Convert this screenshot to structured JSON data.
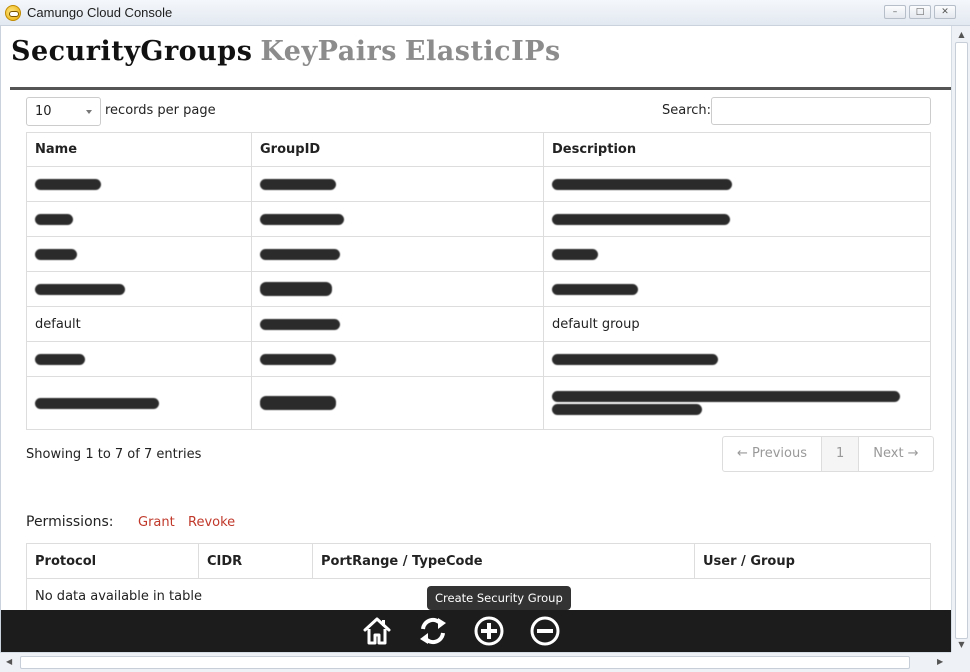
{
  "window": {
    "title": "Camungo Cloud Console"
  },
  "nav": {
    "security_groups": "SecurityGroups",
    "key_pairs": "KeyPairs",
    "elastic_ips": "ElasticIPs"
  },
  "table_controls": {
    "page_length": "10",
    "records_label": "records per page",
    "search_label": "Search:",
    "search_value": ""
  },
  "groups_table": {
    "headers": [
      "Name",
      "GroupID",
      "Description"
    ],
    "rows": [
      [
        "[redacted]",
        "[redacted]",
        "[redacted]"
      ],
      [
        "[redacted]",
        "[redacted]",
        "[redacted]"
      ],
      [
        "[redacted]",
        "[redacted]",
        "[redacted]"
      ],
      [
        "[redacted]",
        "[redacted]",
        "[redacted]"
      ],
      [
        "default",
        "[redacted]",
        "default group"
      ],
      [
        "[redacted]",
        "[redacted]",
        "[redacted]"
      ],
      [
        "[redacted]",
        "[redacted]",
        "[redacted]"
      ]
    ]
  },
  "info_text": "Showing 1 to 7 of 7 entries",
  "pager": {
    "previous": "← Previous",
    "page": "1",
    "next": "Next →"
  },
  "permissions": {
    "label": "Permissions:",
    "grant": "Grant",
    "revoke": "Revoke",
    "headers": [
      "Protocol",
      "CIDR",
      "PortRange / TypeCode",
      "User / Group"
    ],
    "empty": "No data available in table"
  },
  "toolbar": {
    "tooltip": "Create Security Group",
    "buttons": [
      "home-icon",
      "refresh-icon",
      "add-icon",
      "remove-icon"
    ]
  }
}
